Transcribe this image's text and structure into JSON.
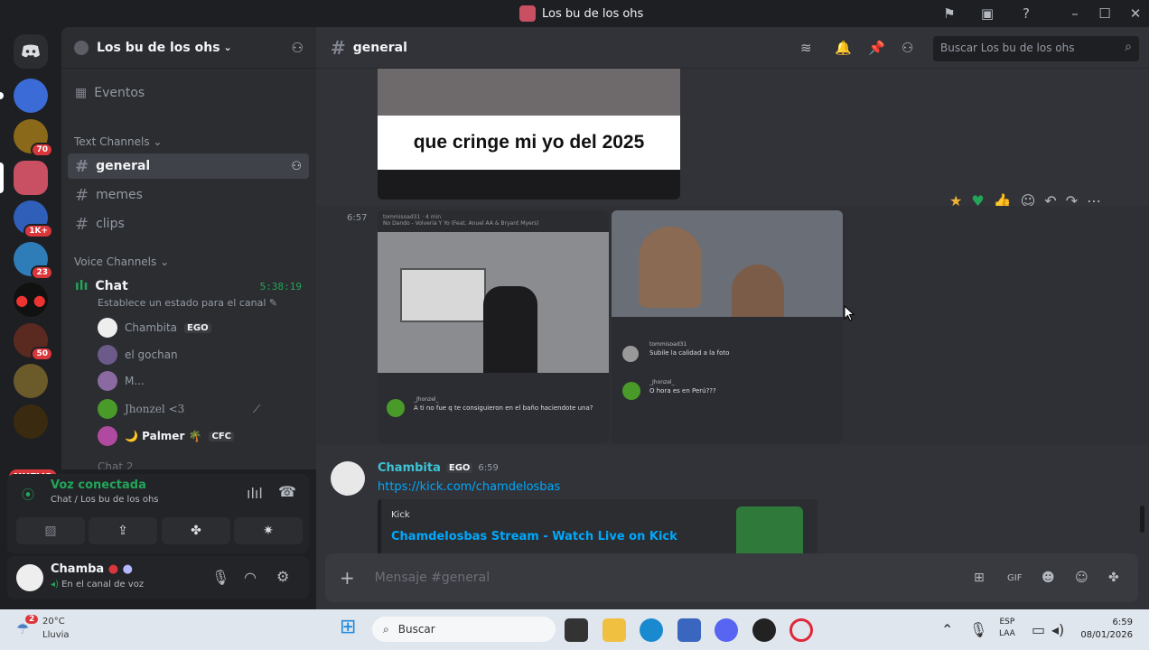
{
  "window": {
    "title": "Los bu de los ohs"
  },
  "guilds": {
    "badges": [
      "70",
      "1K+",
      "23",
      "50"
    ],
    "new_label": "NUEVO"
  },
  "sidebar": {
    "server_name": "Los bu de los ohs",
    "events_label": "Eventos",
    "text_category": "Text Channels",
    "channels": [
      "general",
      "memes",
      "clips"
    ],
    "voice_category": "Voice Channels",
    "voice_channel": {
      "name": "Chat",
      "timer": "5:38:19",
      "status": "Establece un estado para el canal"
    },
    "voice_users": [
      {
        "name": "Chambita",
        "tag": "EGO"
      },
      {
        "name": "el gochan",
        "tag": ""
      },
      {
        "name": "M...",
        "tag": ""
      },
      {
        "name": "Jhonzel <3",
        "tag": ""
      },
      {
        "name": "🌙 Palmer 🌴",
        "tag": "CFC"
      }
    ],
    "next_channel": "Chat 2"
  },
  "voice_panel": {
    "status": "Voz conectada",
    "location": "Chat / Los bu de los ohs"
  },
  "user_panel": {
    "name": "Chamba",
    "status": "En el canal de voz"
  },
  "main": {
    "channel_name": "general",
    "search_placeholder": "Buscar Los bu de los ohs",
    "meme_caption": "que cringe mi yo del 2025",
    "time_left": "6:57",
    "reactions": [
      "star",
      "green-heart",
      "thumbs-up"
    ],
    "shot1": {
      "user": "tommisoad31 · 4 min",
      "song": "No Dando - Volveria Y Yo (Feat. Anuel AA & Bryant Myers)",
      "commenter": "_Jhonzel_",
      "comment": "A ti no fue q te consiguieron en el baño haciendote una?"
    },
    "shot2": {
      "user": "tommisoad31",
      "comment1": "Subile la calidad a la foto",
      "commenter2": "_Jhonzel_",
      "comment2": "O hora es en Perú???"
    },
    "message": {
      "author": "Chambita",
      "tag": "EGO",
      "time": "6:59",
      "link": "https://kick.com/chamdelosbas",
      "embed_provider": "Kick",
      "embed_title": "Chamdelosbas Stream - Watch Live on Kick"
    },
    "input_placeholder": "Mensaje #general"
  },
  "taskbar": {
    "weather_temp": "20°C",
    "weather_desc": "Lluvia",
    "weather_badge": "2",
    "search_label": "Buscar",
    "lang_line1": "ESP",
    "lang_line2": "LAA",
    "time": "6:59",
    "date": "08/01/2026"
  }
}
